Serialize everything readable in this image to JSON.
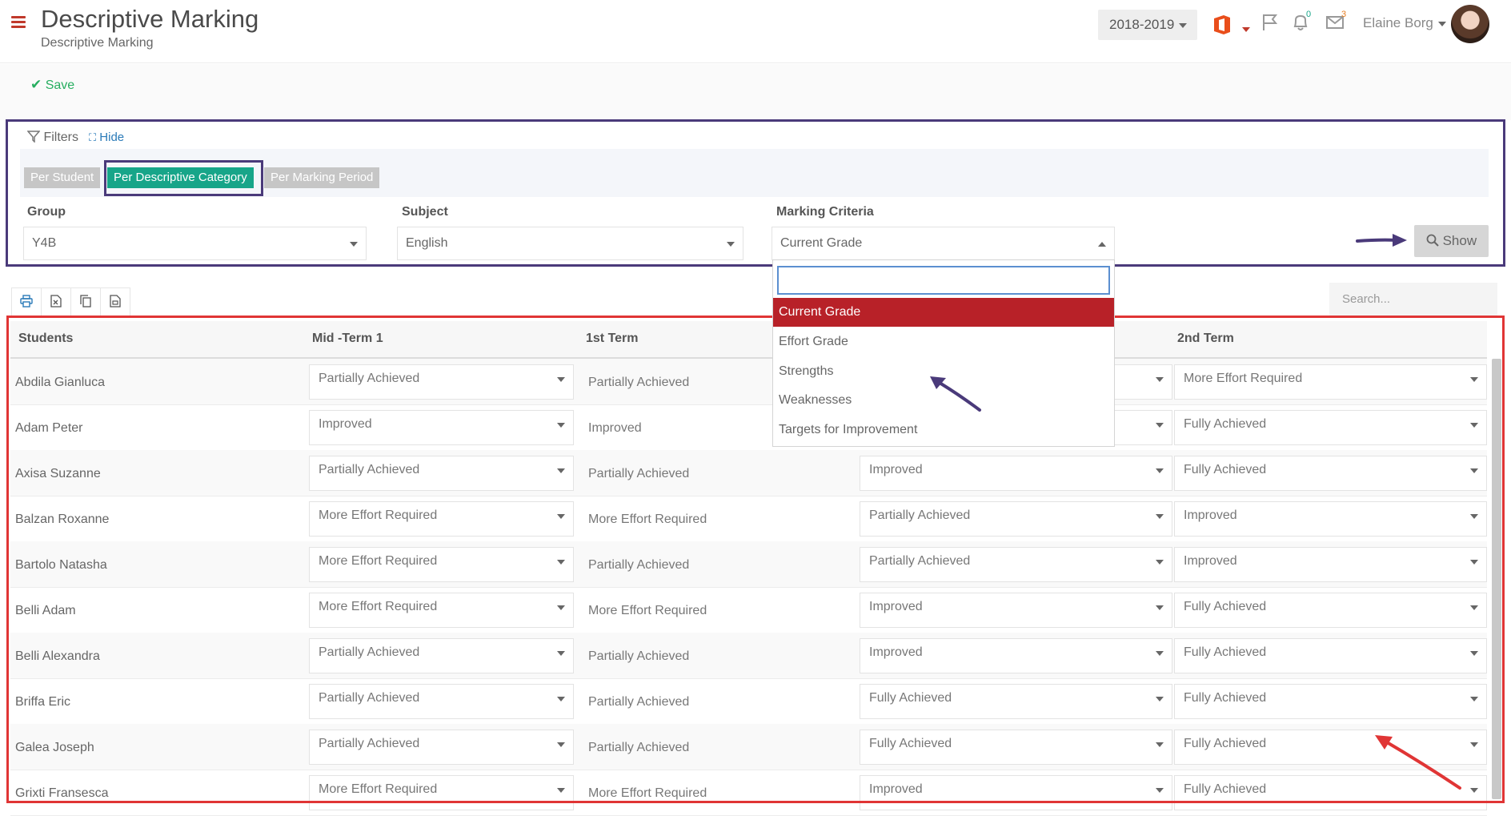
{
  "header": {
    "title": "Descriptive Marking",
    "subtitle": "Descriptive Marking",
    "year": "2018-2019",
    "notification_count": "0",
    "message_count": "3",
    "user_name": "Elaine Borg"
  },
  "toolbar": {
    "save_label": "Save"
  },
  "filters": {
    "label": "Filters",
    "hide_label": "Hide",
    "tabs": [
      "Per Student",
      "Per Descriptive Category",
      "Per Marking Period"
    ],
    "active_tab": "Per Descriptive Category",
    "group_label": "Group",
    "group_value": "Y4B",
    "subject_label": "Subject",
    "subject_value": "English",
    "criteria_label": "Marking Criteria",
    "criteria_value": "Current Grade",
    "show_label": "Show"
  },
  "criteria_dropdown": {
    "search_value": "",
    "options": [
      "Current Grade",
      "Effort Grade",
      "Strengths",
      "Weaknesses",
      "Targets for Improvement"
    ],
    "selected": "Current Grade"
  },
  "table": {
    "search_placeholder": "Search...",
    "columns": [
      "Students",
      "Mid -Term 1",
      "1st Term",
      "2nd Term"
    ],
    "rows": [
      {
        "student": "Abdila Gianluca",
        "mid_term_1": "Partially Achieved",
        "first_term": "Partially Achieved",
        "hidden_col": "",
        "second_term": "More Effort Required"
      },
      {
        "student": "Adam Peter",
        "mid_term_1": "Improved",
        "first_term": "Improved",
        "hidden_col": "",
        "second_term": "Fully Achieved"
      },
      {
        "student": "Axisa Suzanne",
        "mid_term_1": "Partially Achieved",
        "first_term": "Partially Achieved",
        "hidden_col": "Improved",
        "second_term": "Fully Achieved"
      },
      {
        "student": "Balzan Roxanne",
        "mid_term_1": "More Effort Required",
        "first_term": "More Effort Required",
        "hidden_col": "Partially Achieved",
        "second_term": "Improved"
      },
      {
        "student": "Bartolo Natasha",
        "mid_term_1": "More Effort Required",
        "first_term": "Partially Achieved",
        "hidden_col": "Partially Achieved",
        "second_term": "Improved"
      },
      {
        "student": "Belli Adam",
        "mid_term_1": "More Effort Required",
        "first_term": "More Effort Required",
        "hidden_col": "Improved",
        "second_term": "Fully Achieved"
      },
      {
        "student": "Belli Alexandra",
        "mid_term_1": "Partially Achieved",
        "first_term": "Partially Achieved",
        "hidden_col": "Improved",
        "second_term": "Fully Achieved"
      },
      {
        "student": "Briffa Eric",
        "mid_term_1": "Partially Achieved",
        "first_term": "Partially Achieved",
        "hidden_col": "Fully Achieved",
        "second_term": "Fully Achieved"
      },
      {
        "student": "Galea Joseph",
        "mid_term_1": "Partially Achieved",
        "first_term": "Partially Achieved",
        "hidden_col": "Fully Achieved",
        "second_term": "Fully Achieved"
      },
      {
        "student": "Grixti Fransesca",
        "mid_term_1": "More Effort Required",
        "first_term": "More Effort Required",
        "hidden_col": "Improved",
        "second_term": "Fully Achieved"
      }
    ]
  },
  "colors": {
    "accent_green": "#17a589",
    "annotation_purple": "#4a3a7a",
    "annotation_red": "#e03535",
    "selected_red": "#b82128"
  }
}
